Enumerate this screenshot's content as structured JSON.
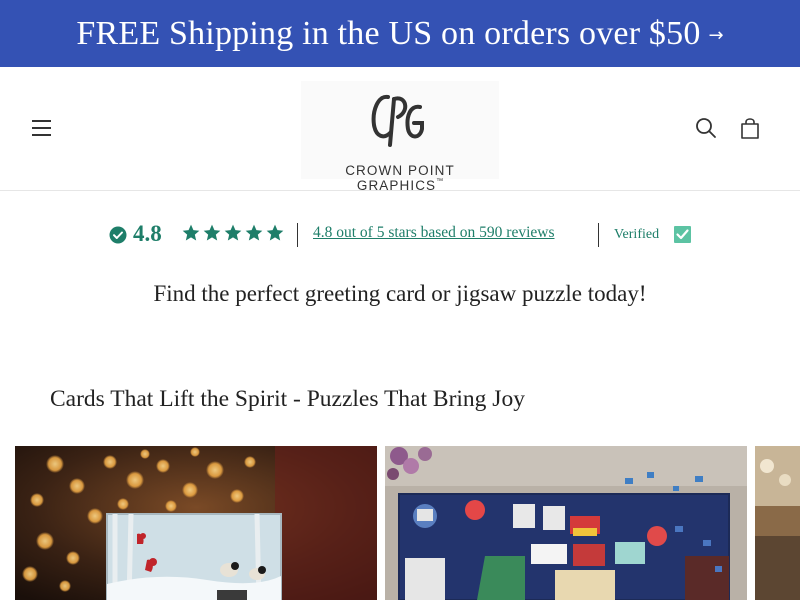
{
  "announcement": {
    "text": "FREE Shipping in the US on orders over $50",
    "arrow": "→"
  },
  "header": {
    "logo": {
      "monogram": "CPG",
      "name": "CROWN POINT GRAPHICS",
      "trademark": "™"
    },
    "icons": [
      "menu-icon",
      "search-icon",
      "cart-icon"
    ]
  },
  "reviews": {
    "score": "4.8",
    "stars": 5,
    "summary_link": "4.8 out of 5 stars based on 590 reviews",
    "verified_label": "Verified",
    "accent_color": "#1e7e69"
  },
  "tagline": "Find the perfect greeting card or jigsaw puzzle today!",
  "section": {
    "title": "Cards That Lift the Spirit - Puzzles That Bring Joy"
  },
  "colors": {
    "announcement_bg": "#3452b4",
    "accent": "#1e7e69"
  }
}
